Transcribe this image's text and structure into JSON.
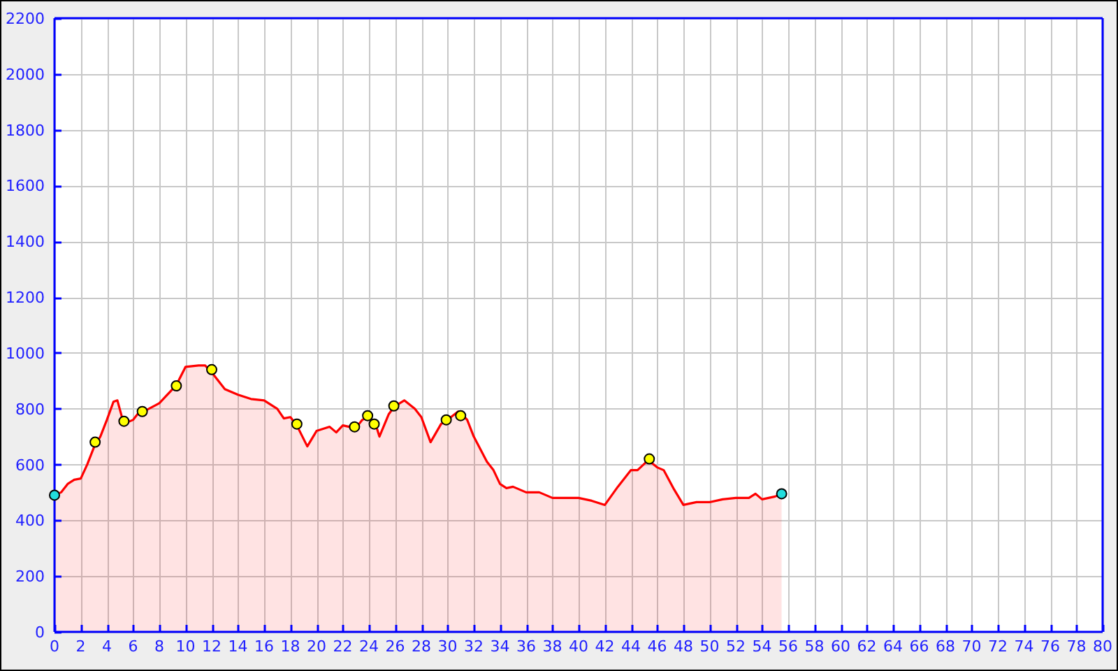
{
  "chart": {
    "chart_data": {
      "type": "area",
      "x": [
        0,
        0.5,
        1,
        1.5,
        2,
        2.5,
        3,
        3.1,
        3.5,
        4,
        4.5,
        4.8,
        5.2,
        5.3,
        5.5,
        6,
        6.5,
        6.7,
        7,
        8,
        9,
        9.3,
        10,
        11,
        11.5,
        12,
        13,
        14,
        15,
        16,
        17,
        17.5,
        18,
        18.5,
        19.3,
        20,
        21,
        21.5,
        22,
        22.5,
        22.9,
        23,
        23.5,
        23.9,
        24,
        24.4,
        24.5,
        24.8,
        25.5,
        25.9,
        26,
        26.7,
        27.5,
        28,
        28.7,
        29.5,
        29.9,
        30,
        30.8,
        31,
        31.5,
        32,
        33,
        33.5,
        34,
        34.5,
        35,
        36,
        37,
        38,
        39,
        40,
        41,
        42,
        43,
        44,
        44.5,
        45.3,
        45.4,
        46,
        46.5,
        47.3,
        48,
        49,
        50,
        51,
        52,
        53,
        53.5,
        54,
        55,
        55.5
      ],
      "series": [
        {
          "color": "#ff0000",
          "values": [
            490,
            500,
            530,
            545,
            550,
            600,
            660,
            670,
            700,
            760,
            825,
            830,
            760,
            755,
            750,
            760,
            790,
            790,
            795,
            820,
            870,
            885,
            950,
            955,
            955,
            930,
            870,
            850,
            835,
            830,
            800,
            765,
            770,
            740,
            665,
            720,
            735,
            715,
            740,
            735,
            732,
            730,
            760,
            768,
            770,
            750,
            745,
            700,
            780,
            805,
            810,
            830,
            800,
            770,
            680,
            745,
            757,
            760,
            790,
            785,
            760,
            700,
            610,
            580,
            530,
            515,
            520,
            500,
            500,
            480,
            480,
            480,
            470,
            455,
            520,
            580,
            580,
            615,
            613,
            590,
            580,
            510,
            455,
            465,
            465,
            475,
            480,
            480,
            495,
            475,
            485,
            495
          ]
        },
        {
          "type": "scatter",
          "color": "#ffff00",
          "values": [
            null,
            null,
            null,
            null,
            null,
            null,
            null,
            680,
            null,
            null,
            null,
            null,
            null,
            755,
            null,
            null,
            null,
            790,
            null,
            null,
            null,
            882,
            null,
            null,
            null,
            940,
            null,
            null,
            null,
            null,
            null,
            null,
            null,
            745,
            null,
            null,
            null,
            null,
            null,
            null,
            735,
            null,
            null,
            775,
            null,
            745,
            null,
            null,
            null,
            810,
            null,
            null,
            null,
            null,
            null,
            null,
            760,
            null,
            null,
            775,
            null,
            null,
            null,
            null,
            null,
            null,
            null,
            null,
            null,
            null,
            null,
            null,
            null,
            null,
            null,
            null,
            null,
            null,
            620,
            null,
            null,
            null,
            null,
            null,
            null,
            null,
            null,
            null,
            null,
            null,
            null,
            null
          ]
        },
        {
          "type": "scatter",
          "color": "#22dddd",
          "values": [
            490,
            null,
            null,
            null,
            null,
            null,
            null,
            null,
            null,
            null,
            null,
            null,
            null,
            null,
            null,
            null,
            null,
            null,
            null,
            null,
            null,
            null,
            null,
            null,
            null,
            null,
            null,
            null,
            null,
            null,
            null,
            null,
            null,
            null,
            null,
            null,
            null,
            null,
            null,
            null,
            null,
            null,
            null,
            null,
            null,
            null,
            null,
            null,
            null,
            null,
            null,
            null,
            null,
            null,
            null,
            null,
            null,
            null,
            null,
            null,
            null,
            null,
            null,
            null,
            null,
            null,
            null,
            null,
            null,
            null,
            null,
            null,
            null,
            null,
            null,
            null,
            null,
            null,
            null,
            null,
            null,
            null,
            null,
            null,
            null,
            null,
            null,
            null,
            null,
            null,
            null,
            495
          ]
        }
      ],
      "xlim": [
        0,
        80
      ],
      "ylim": [
        0,
        2200
      ],
      "grid": true,
      "xticks": [
        0,
        2,
        4,
        6,
        8,
        10,
        12,
        14,
        16,
        18,
        20,
        22,
        24,
        26,
        28,
        30,
        32,
        34,
        36,
        38,
        40,
        42,
        44,
        46,
        48,
        50,
        52,
        54,
        56,
        58,
        60,
        62,
        64,
        66,
        68,
        70,
        72,
        74,
        76,
        78,
        80
      ],
      "yticks": [
        0,
        200,
        400,
        600,
        800,
        1000,
        1200,
        1400,
        1600,
        1800,
        2000,
        2200
      ]
    }
  }
}
